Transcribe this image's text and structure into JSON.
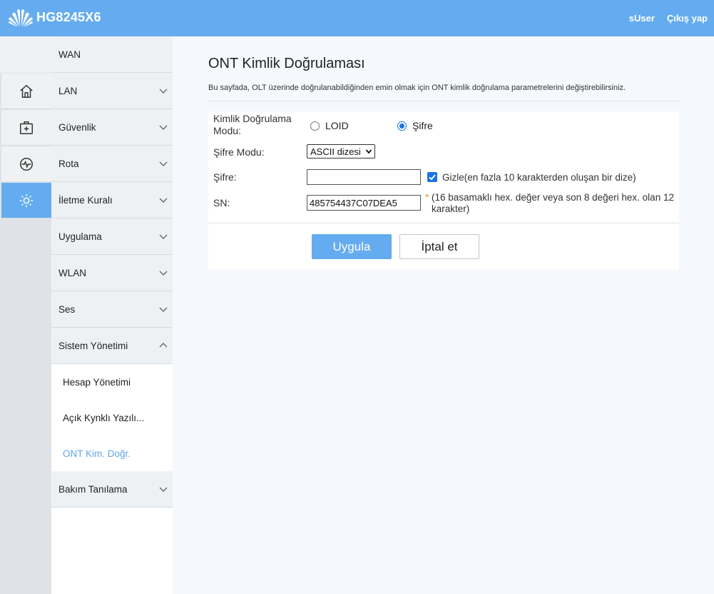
{
  "header": {
    "brand": "HG8245X6",
    "user": "sUser",
    "logout": "Çıkış yap"
  },
  "icon_strip": [
    {
      "icon": "home-icon"
    },
    {
      "icon": "first-aid-icon"
    },
    {
      "icon": "pulse-icon"
    },
    {
      "icon": "gear-icon",
      "active": true
    }
  ],
  "menu": {
    "items": [
      {
        "label": "WAN"
      },
      {
        "label": "LAN"
      },
      {
        "label": "Güvenlik"
      },
      {
        "label": "Rota"
      },
      {
        "label": "İletme Kuralı"
      },
      {
        "label": "Uygulama"
      },
      {
        "label": "WLAN"
      },
      {
        "label": "Ses"
      },
      {
        "label": "Sistem Yönetimi",
        "expanded": true
      }
    ],
    "sub_items": [
      {
        "label": "Hesap Yönetimi"
      },
      {
        "label": "Açık Kynklı Yazılı..."
      },
      {
        "label": "ONT Kim. Doğr.",
        "selected": true
      }
    ],
    "last_item": {
      "label": "Bakım Tanılama"
    }
  },
  "main": {
    "title": "ONT Kimlik Doğrulaması",
    "description": "Bu sayfada, OLT üzerinde doğrulanabildiğinden emin olmak için ONT kimlik doğrulama parametrelerini değiştirebilirsiniz.",
    "form": {
      "auth_mode_label": "Kimlik Doğrulama Modu:",
      "auth_mode_options": [
        "LOID",
        "Şifre"
      ],
      "auth_mode_selected": "Şifre",
      "password_mode_label": "Şifre Modu:",
      "password_mode_value": "ASCII dizesi",
      "password_label": "Şifre:",
      "password_value": "",
      "hide_checked": true,
      "hide_label": "Gizle(en fazla 10 karakterden oluşan bir dize)",
      "sn_label": "SN:",
      "sn_value": "485754437C07DEA5",
      "sn_required_mark": "*",
      "sn_hint": "(16 basamaklı hex. değer veya son 8 değeri hex. olan 12 karakter)"
    },
    "buttons": {
      "apply": "Uygula",
      "cancel": "İptal et"
    }
  },
  "colors": {
    "accent": "#64acef",
    "selected_text": "#5ea6ec",
    "required": "#e8912d"
  }
}
